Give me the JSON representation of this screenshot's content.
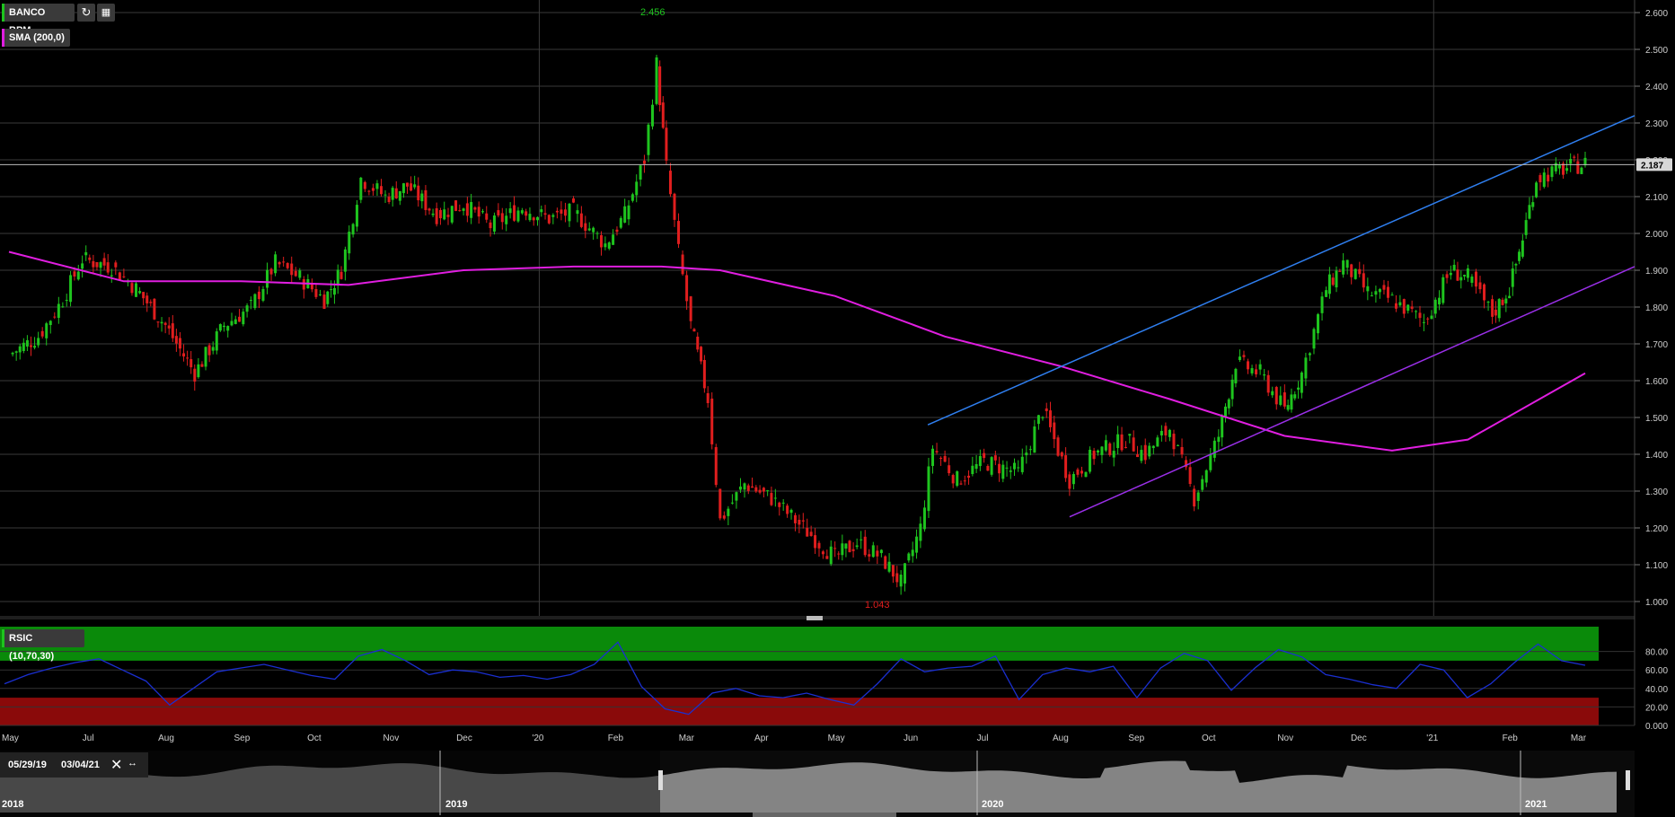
{
  "header": {
    "symbol": "BANCO BPM",
    "indicator": "SMA (200,0)",
    "rsi_label": "RSIC (10,70,30)"
  },
  "navigator": {
    "start_date": "05/29/19",
    "end_date": "03/04/21",
    "years": [
      "2018",
      "2019",
      "2020",
      "2021"
    ]
  },
  "colors": {
    "up": "#1ec41e",
    "down": "#e01e1e",
    "sma": "#e01ee0",
    "channel_upper": "#2f7ff0",
    "channel_lower": "#9a2fe8",
    "rsi_line": "#1a2fd0",
    "overbought_zone": "#0a8a0a",
    "oversold_zone": "#8a0a0a"
  },
  "chart_data": [
    {
      "type": "candlestick",
      "title": "BANCO BPM",
      "x_axis": [
        "May",
        "Jul",
        "Aug",
        "Sep",
        "Oct",
        "Nov",
        "Dec",
        "'20",
        "Feb",
        "Mar",
        "Apr",
        "May",
        "Jun",
        "Jul",
        "Aug",
        "Sep",
        "Oct",
        "Nov",
        "Dec",
        "'21",
        "Feb",
        "Mar"
      ],
      "y_ticks": [
        "2.600",
        "2.500",
        "2.400",
        "2.300",
        "2.200",
        "2.100",
        "2.000",
        "1.900",
        "1.800",
        "1.700",
        "1.600",
        "1.500",
        "1.400",
        "1.300",
        "1.200",
        "1.100",
        "1.000"
      ],
      "ylim": [
        0.97,
        2.63
      ],
      "last_price": "2.187",
      "annotations": {
        "high": "2.456",
        "low": "1.043"
      },
      "close_path": [
        [
          "2019-05-29",
          1.67
        ],
        [
          "2019-06-10",
          1.72
        ],
        [
          "2019-06-20",
          1.82
        ],
        [
          "2019-06-28",
          1.93
        ],
        [
          "2019-07-10",
          1.91
        ],
        [
          "2019-07-20",
          1.85
        ],
        [
          "2019-08-01",
          1.75
        ],
        [
          "2019-08-13",
          1.62
        ],
        [
          "2019-08-25",
          1.75
        ],
        [
          "2019-09-05",
          1.8
        ],
        [
          "2019-09-15",
          1.92
        ],
        [
          "2019-09-25",
          1.88
        ],
        [
          "2019-10-05",
          1.82
        ],
        [
          "2019-10-12",
          1.9
        ],
        [
          "2019-10-20",
          2.15
        ],
        [
          "2019-10-30",
          2.1
        ],
        [
          "2019-11-08",
          2.13
        ],
        [
          "2019-11-20",
          2.05
        ],
        [
          "2019-12-01",
          2.08
        ],
        [
          "2019-12-12",
          2.02
        ],
        [
          "2019-12-25",
          2.07
        ],
        [
          "2020-01-05",
          2.04
        ],
        [
          "2020-01-15",
          2.06
        ],
        [
          "2020-01-28",
          1.97
        ],
        [
          "2020-02-05",
          2.05
        ],
        [
          "2020-02-13",
          2.2
        ],
        [
          "2020-02-18",
          2.46
        ],
        [
          "2020-02-22",
          2.18
        ],
        [
          "2020-02-27",
          1.95
        ],
        [
          "2020-03-03",
          1.75
        ],
        [
          "2020-03-10",
          1.55
        ],
        [
          "2020-03-15",
          1.22
        ],
        [
          "2020-03-25",
          1.32
        ],
        [
          "2020-04-05",
          1.28
        ],
        [
          "2020-04-18",
          1.2
        ],
        [
          "2020-05-01",
          1.12
        ],
        [
          "2020-05-10",
          1.16
        ],
        [
          "2020-05-20",
          1.12
        ],
        [
          "2020-05-28",
          1.05
        ],
        [
          "2020-06-05",
          1.2
        ],
        [
          "2020-06-10",
          1.42
        ],
        [
          "2020-06-20",
          1.33
        ],
        [
          "2020-07-01",
          1.38
        ],
        [
          "2020-07-15",
          1.35
        ],
        [
          "2020-07-25",
          1.52
        ],
        [
          "2020-08-05",
          1.33
        ],
        [
          "2020-08-15",
          1.4
        ],
        [
          "2020-08-28",
          1.44
        ],
        [
          "2020-09-05",
          1.4
        ],
        [
          "2020-09-15",
          1.47
        ],
        [
          "2020-09-25",
          1.28
        ],
        [
          "2020-10-05",
          1.45
        ],
        [
          "2020-10-12",
          1.65
        ],
        [
          "2020-10-22",
          1.62
        ],
        [
          "2020-11-01",
          1.52
        ],
        [
          "2020-11-08",
          1.62
        ],
        [
          "2020-11-18",
          1.85
        ],
        [
          "2020-11-25",
          1.92
        ],
        [
          "2020-12-05",
          1.84
        ],
        [
          "2020-12-15",
          1.82
        ],
        [
          "2020-12-28",
          1.76
        ],
        [
          "2021-01-08",
          1.9
        ],
        [
          "2021-01-15",
          1.88
        ],
        [
          "2021-01-25",
          1.78
        ],
        [
          "2021-02-01",
          1.85
        ],
        [
          "2021-02-05",
          1.95
        ],
        [
          "2021-02-12",
          2.15
        ],
        [
          "2021-02-20",
          2.17
        ],
        [
          "2021-03-04",
          2.19
        ]
      ],
      "sma_200": [
        [
          "2019-05-29",
          1.95
        ],
        [
          "2019-07-15",
          1.87
        ],
        [
          "2019-09-01",
          1.87
        ],
        [
          "2019-10-15",
          1.86
        ],
        [
          "2019-12-01",
          1.9
        ],
        [
          "2020-01-15",
          1.91
        ],
        [
          "2020-02-20",
          1.91
        ],
        [
          "2020-03-15",
          1.9
        ],
        [
          "2020-05-01",
          1.83
        ],
        [
          "2020-06-15",
          1.72
        ],
        [
          "2020-08-01",
          1.64
        ],
        [
          "2020-09-15",
          1.55
        ],
        [
          "2020-11-01",
          1.45
        ],
        [
          "2020-12-15",
          1.41
        ],
        [
          "2021-01-15",
          1.44
        ],
        [
          "2021-03-04",
          1.62
        ]
      ],
      "trendlines": [
        {
          "name": "channel-upper",
          "from": [
            "2020-06-08",
            1.48
          ],
          "to": [
            "2021-03-25",
            2.32
          ]
        },
        {
          "name": "channel-lower",
          "from": [
            "2020-08-05",
            1.23
          ],
          "to": [
            "2021-03-25",
            1.91
          ]
        }
      ]
    },
    {
      "type": "line",
      "title": "RSIC (10,70,30)",
      "y_ticks": [
        "80.00",
        "60.00",
        "40.00",
        "20.00",
        "0.000"
      ],
      "ylim": [
        0,
        100
      ],
      "zones": {
        "overbought": 70,
        "oversold": 30
      },
      "values": [
        45,
        55,
        62,
        68,
        72,
        60,
        48,
        22,
        40,
        58,
        62,
        66,
        60,
        54,
        50,
        75,
        82,
        70,
        55,
        60,
        58,
        52,
        54,
        50,
        55,
        66,
        90,
        42,
        18,
        12,
        35,
        40,
        32,
        30,
        35,
        28,
        22,
        45,
        72,
        58,
        62,
        64,
        75,
        28,
        55,
        62,
        58,
        64,
        30,
        62,
        78,
        70,
        38,
        62,
        82,
        74,
        55,
        50,
        44,
        40,
        66,
        60,
        30,
        45,
        68,
        88,
        70,
        65
      ]
    }
  ]
}
